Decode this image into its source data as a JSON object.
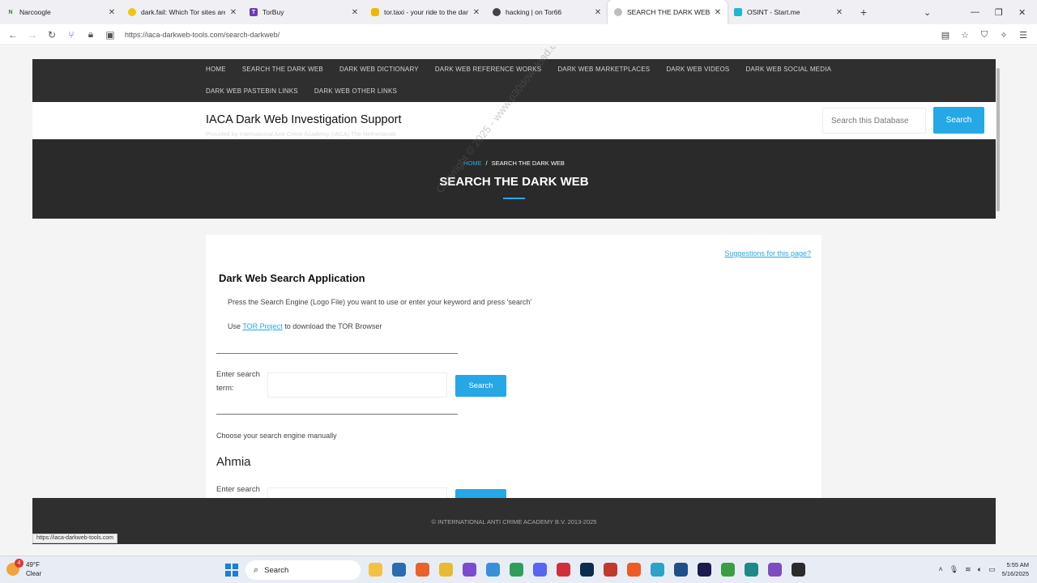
{
  "browser": {
    "tabs": [
      {
        "label": "Narcoogle",
        "icon": "narcoogle-icon",
        "color": "#2e7d32",
        "glyph": "N",
        "active": false
      },
      {
        "label": "dark.fail: Which Tor sites are on",
        "icon": "darkfail-icon",
        "color": "#f1c40f",
        "glyph": "",
        "active": false
      },
      {
        "label": "TorBuy",
        "icon": "torbuy-icon",
        "color": "#6a3ab8",
        "glyph": "T",
        "active": false
      },
      {
        "label": "tor.taxi - your ride to the darkne",
        "icon": "tortaxi-icon",
        "color": "#f2b705",
        "glyph": "",
        "active": false
      },
      {
        "label": "hacking | on Tor66",
        "icon": "tor66-icon",
        "color": "#444444",
        "glyph": "",
        "active": false
      },
      {
        "label": "SEARCH THE DARK WEB – IACA",
        "icon": "iaca-tab-icon",
        "color": "#bdbdbd",
        "glyph": "",
        "active": true
      },
      {
        "label": "OSINT - Start.me",
        "icon": "startme-icon",
        "color": "#1fb6d6",
        "glyph": "",
        "active": false
      }
    ],
    "url": "https://iaca-darkweb-tools.com/search-darkweb/",
    "status_url": "https://iaca-darkweb-tools.com"
  },
  "site": {
    "nav_row1": [
      "HOME",
      "SEARCH THE DARK WEB",
      "DARK WEB DICTIONARY",
      "DARK WEB REFERENCE WORKS",
      "DARK WEB MARKETPLACES",
      "DARK WEB VIDEOS",
      "DARK WEB SOCIAL MEDIA"
    ],
    "nav_row2": [
      "DARK WEB PASTEBIN LINKS",
      "DARK WEB OTHER LINKS"
    ],
    "title": "IACA Dark Web Investigation Support",
    "tagline": "Provided by International Anti Crime Academy (IACA) The Netherlands",
    "search_placeholder": "Search this Database",
    "search_button": "Search",
    "accent": "#26a7e6"
  },
  "hero": {
    "crumb_home": "HOME",
    "crumb_sep": "/",
    "crumb_current": "SEARCH THE DARK WEB",
    "title": "SEARCH THE DARK WEB"
  },
  "content": {
    "suggestions_link": "Suggestions for this page?",
    "heading": "Dark Web Search Application",
    "instruction": "Press the Search Engine (Logo File) you want to use or enter your keyword and press 'search'",
    "tor_prefix": "Use ",
    "tor_link": "TOR Project",
    "tor_suffix": " to download the TOR Browser",
    "enter_label": "Enter search term:",
    "enter_label_partial": "Enter search",
    "search_button": "Search",
    "choose_text": "Choose your search engine manually",
    "engine_name": "Ahmia"
  },
  "footer": {
    "copyright": "© INTERNATIONAL ANTI CRIME ACADEMY B.V. 2013-2025"
  },
  "watermark": "Copyright © 2025 - www.p30download.com",
  "taskbar": {
    "weather_temp": "49°F",
    "weather_desc": "Clear",
    "weather_badge": "4",
    "search_label": "Search",
    "time": "5:55 AM",
    "date": "5/16/2025",
    "apps": [
      {
        "name": "file-explorer-icon",
        "color": "#f3c145"
      },
      {
        "name": "microsoft-store-icon",
        "color": "#2b6cb0"
      },
      {
        "name": "firefox-icon",
        "color": "#e8632a"
      },
      {
        "name": "folder-icon",
        "color": "#e8b931"
      },
      {
        "name": "app-purple-icon",
        "color": "#7b4bd1"
      },
      {
        "name": "snipping-tool-icon",
        "color": "#3a8fd9"
      },
      {
        "name": "app-green-icon",
        "color": "#2e9e5b"
      },
      {
        "name": "discord-icon",
        "color": "#5865f2"
      },
      {
        "name": "opera-icon",
        "color": "#d12e3a"
      },
      {
        "name": "photoshop-icon",
        "color": "#0d2a4f"
      },
      {
        "name": "app-red-icon",
        "color": "#c0392b"
      },
      {
        "name": "brave-icon",
        "color": "#ef5b25"
      },
      {
        "name": "app-vscode-icon",
        "color": "#2aa3c9"
      },
      {
        "name": "app-blue-icon",
        "color": "#1f4f8b"
      },
      {
        "name": "character-animator-icon",
        "color": "#1b1b4f"
      },
      {
        "name": "notepad-green-icon",
        "color": "#3c9e43"
      },
      {
        "name": "app-teal-icon",
        "color": "#1c8a86"
      },
      {
        "name": "tor-browser-icon",
        "color": "#7e4cc2"
      },
      {
        "name": "github-desktop-icon",
        "color": "#2b2b2b"
      }
    ]
  }
}
